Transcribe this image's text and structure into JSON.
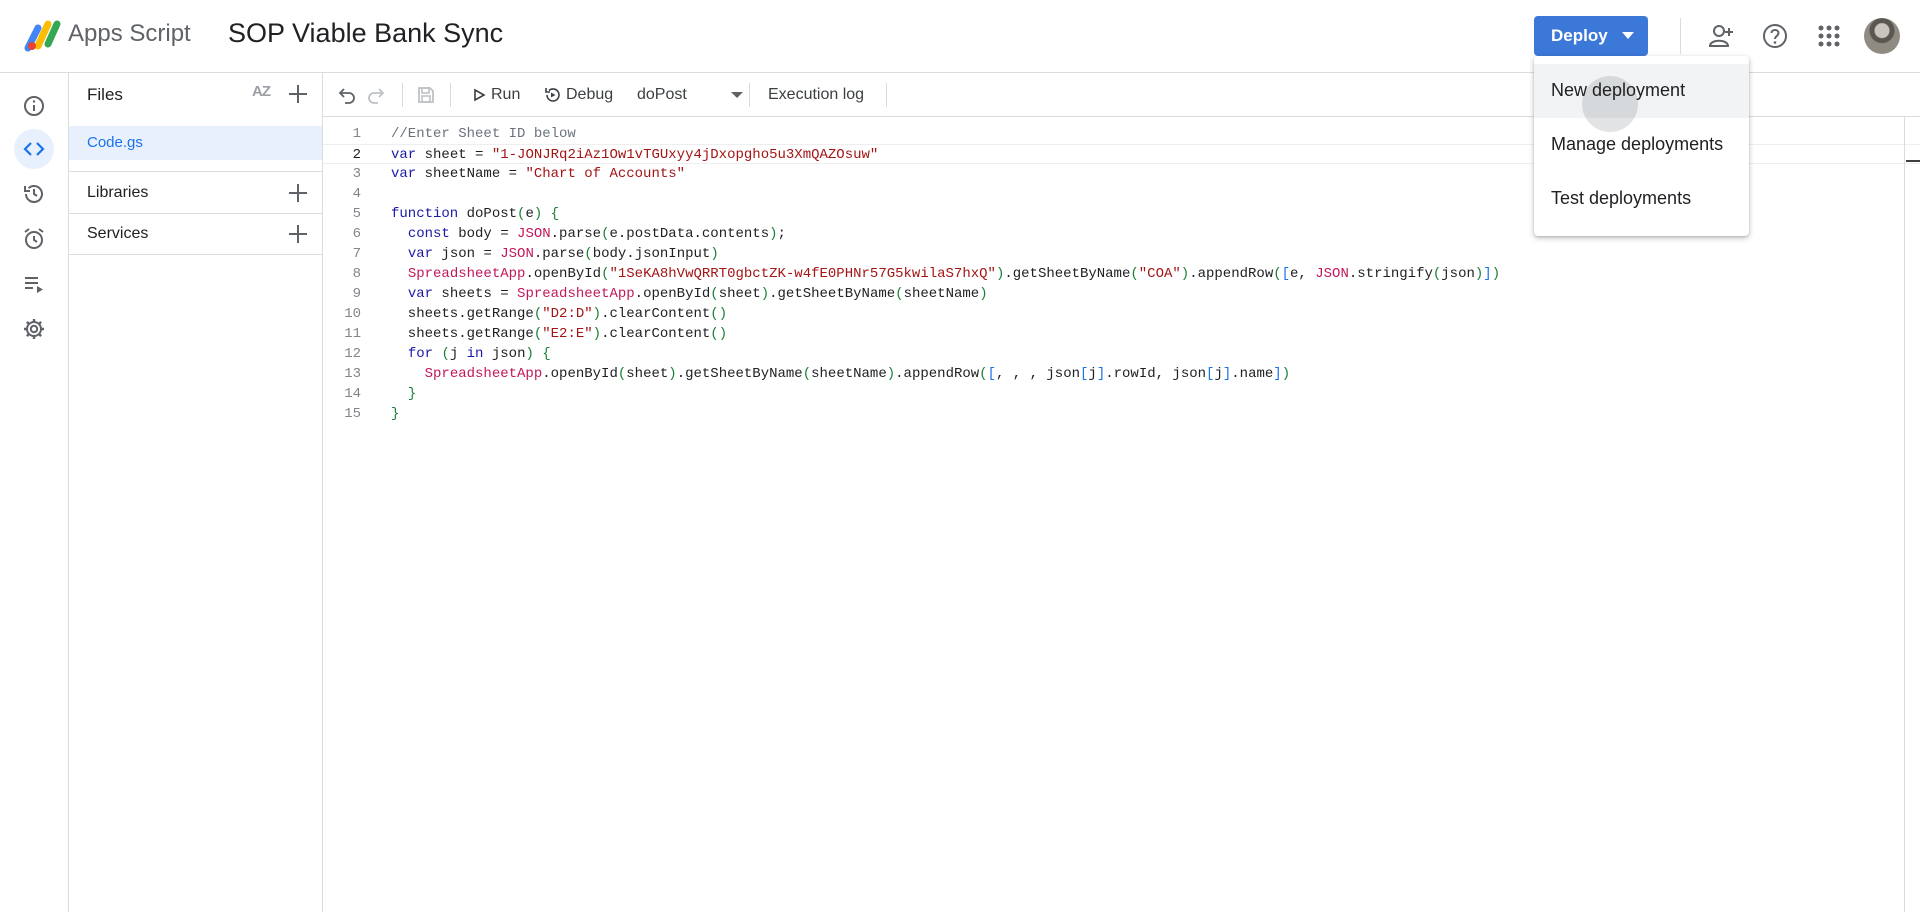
{
  "header": {
    "app_name": "Apps Script",
    "project_title": "SOP Viable Bank Sync",
    "deploy_label": "Deploy"
  },
  "deploy_menu": {
    "items": [
      "New deployment",
      "Manage deployments",
      "Test deployments"
    ]
  },
  "files_panel": {
    "title": "Files",
    "sort_label": "AZ",
    "files": [
      "Code.gs"
    ],
    "sections": [
      "Libraries",
      "Services"
    ]
  },
  "toolbar": {
    "run_label": "Run",
    "debug_label": "Debug",
    "function_name": "doPost",
    "execution_log_label": "Execution log"
  },
  "editor": {
    "current_line": 2,
    "lines": [
      "//Enter Sheet ID below",
      "var sheet = \"1-JONJRq2iAz1Ow1vTGUxyy4jDxopgho5u3XmQAZOsuw\"",
      "var sheetName = \"Chart of Accounts\"",
      "",
      "function doPost(e) {",
      "  const body = JSON.parse(e.postData.contents);",
      "  var json = JSON.parse(body.jsonInput)",
      "  SpreadsheetApp.openById(\"1SeKA8hVwQRRT0gbctZK-w4fE0PHNr57G5kwilaS7hxQ\").getSheetByName(\"COA\").appendRow([e, JSON.stringify(json)])",
      "  var sheets = SpreadsheetApp.openById(sheet).getSheetByName(sheetName)",
      "  sheets.getRange(\"D2:D\").clearContent()",
      "  sheets.getRange(\"E2:E\").clearContent()",
      "  for (j in json) {",
      "    SpreadsheetApp.openById(sheet).getSheetByName(sheetName).appendRow([, , , json[j].rowId, json[j].name])",
      "  }",
      "}"
    ]
  },
  "colors": {
    "accent": "#1a73e8",
    "deploy_button": "#3c78d8",
    "string": "#a31515",
    "keyword": "#1a1aa6",
    "object": "#c2185b"
  }
}
